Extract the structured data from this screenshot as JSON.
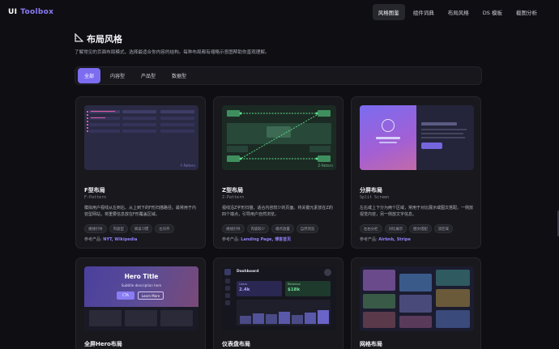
{
  "app": {
    "logo_main": "UI",
    "logo_accent": "Toolbox"
  },
  "nav": [
    {
      "label": "风格图鉴",
      "active": true
    },
    {
      "label": "组件词典",
      "active": false
    },
    {
      "label": "布局风格",
      "active": false
    },
    {
      "label": "DS 模板",
      "active": false
    },
    {
      "label": "截图分析",
      "active": false
    }
  ],
  "page": {
    "icon": "ruler-icon",
    "title": "布局风格",
    "subtitle": "了解常见的页面布局模式，选择最适合你内容的结构。每种布局都有缩略示意图帮助你直观理解。"
  },
  "filters": [
    {
      "label": "全部",
      "active": true
    },
    {
      "label": "内容型",
      "active": false
    },
    {
      "label": "产品型",
      "active": false
    },
    {
      "label": "数据型",
      "active": false
    }
  ],
  "cards": [
    {
      "title": "F型布局",
      "subtitle_en": "F-Pattern",
      "thumb_label": "F-Pattern",
      "desc": "模拟用户视线从左到右、从上到下的F形扫描路径。最常用于内容型网站，将重要信息放在F形覆盖区域。",
      "tags": [
        "视线引导",
        "内容型",
        "阅读习惯",
        "左对齐"
      ],
      "ref_prefix": "参考产品:",
      "ref_links": "NYT, Wikipedia"
    },
    {
      "title": "Z型布局",
      "subtitle_en": "Z-Pattern",
      "thumb_label": "Z-Pattern",
      "desc": "视线沿Z字形扫描，适合内容较少的页面。将关键元素放在Z的四个端点，引导用户自然浏览。",
      "tags": [
        "视线引导",
        "内容较少",
        "端点放置",
        "自然浏览"
      ],
      "ref_prefix": "参考产品:",
      "ref_links": "Landing Page, 博客首页"
    },
    {
      "title": "分屏布局",
      "subtitle_en": "Split Screen",
      "desc": "左右或上下分为两个区域，常用于对比展示或图文搭配。一侧放视觉内容，另一侧放文字信息。",
      "tags": [
        "左右分栏",
        "对比展示",
        "图文搭配",
        "双区域"
      ],
      "ref_prefix": "参考产品:",
      "ref_links": "Airbnb, Stripe"
    },
    {
      "title": "全屏Hero布局",
      "hero_title": "Hero Title",
      "hero_sub": "Subtitle description here",
      "hero_cta": "CTA",
      "hero_more": "Learn More"
    },
    {
      "title": "仪表盘布局",
      "dash_title": "Dashboard",
      "stat1_label": "Users",
      "stat1_value": "2.4k",
      "stat2_label": "Revenue",
      "stat2_value": "$18k"
    },
    {
      "title": "网格布局"
    }
  ],
  "colors": {
    "accent": "#7c6cf0",
    "bg": "#0f0f13",
    "card": "#18181d",
    "link": "#8f80f8"
  }
}
